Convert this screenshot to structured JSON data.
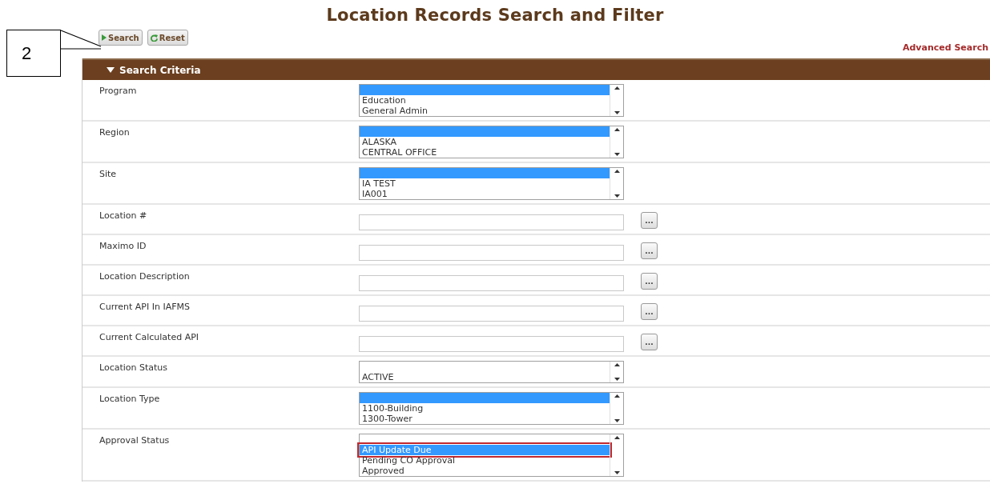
{
  "title": "Location Records Search and Filter",
  "callout": {
    "number": "2"
  },
  "toolbar": {
    "buttons": [
      {
        "kind": "search",
        "label": "Search"
      },
      {
        "kind": "reset",
        "label": "Reset"
      }
    ],
    "link": "Advanced Search"
  },
  "panel": {
    "title": "Search Criteria",
    "expanded": true,
    "fields": [
      {
        "kind": "listbox",
        "label": "Program",
        "options": [
          {
            "selected": true
          },
          {
            "label": "Education",
            "selected": false
          },
          {
            "label": "General Admin",
            "selected": false
          }
        ]
      },
      {
        "kind": "listbox",
        "label": "Region",
        "options": [
          {
            "selected": true
          },
          {
            "label": "ALASKA",
            "selected": false
          },
          {
            "label": "CENTRAL OFFICE",
            "selected": false
          }
        ]
      },
      {
        "kind": "listbox",
        "label": "Site",
        "options": [
          {
            "selected": true
          },
          {
            "label": "IA TEST",
            "selected": false
          },
          {
            "label": "IA001",
            "selected": false
          }
        ]
      },
      {
        "kind": "lookup",
        "label": "Location #",
        "button": "..."
      },
      {
        "kind": "lookup",
        "label": "Maximo ID",
        "button": "..."
      },
      {
        "kind": "lookup",
        "label": "Location Description",
        "button": "..."
      },
      {
        "kind": "lookup",
        "label": "Current API In IAFMS",
        "button": "..."
      },
      {
        "kind": "lookup",
        "label": "Current Calculated API",
        "button": "..."
      },
      {
        "kind": "listbox",
        "label": "Location Status",
        "options": [
          {
            "selected": false
          },
          {
            "label": "ACTIVE",
            "selected": false
          }
        ]
      },
      {
        "kind": "listbox",
        "label": "Location Type",
        "options": [
          {
            "selected": true
          },
          {
            "label": "1100-Building",
            "selected": false
          },
          {
            "label": "1300-Tower",
            "selected": false
          }
        ]
      },
      {
        "kind": "listbox",
        "label": "Approval Status",
        "options": [
          {
            "selected": false
          },
          {
            "label": "API Update Due",
            "selected": true,
            "highlighted": true
          },
          {
            "label": "Pending CO Approval",
            "selected": false
          },
          {
            "label": "Approved",
            "selected": false
          }
        ]
      }
    ]
  }
}
